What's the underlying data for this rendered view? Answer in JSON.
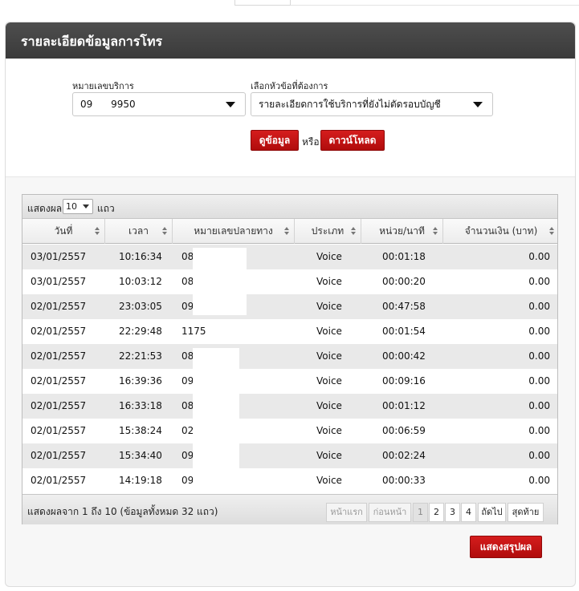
{
  "panel": {
    "title": "รายละเอียดข้อมูลการโทร"
  },
  "form": {
    "phone_label": "หมายเลขบริการ",
    "phone_value": "09      9950",
    "topic_label": "เลือกหัวข้อที่ต้องการ",
    "topic_value": "รายละเอียดการใช้บริการที่ยังไม่ตัดรอบบัญชี",
    "view_button": "ดูข้อมูล",
    "or_text": "หรือ",
    "download_button": "ดาวน์โหลด"
  },
  "table": {
    "show_label": "แสดงผล",
    "page_length": "10",
    "rows_label": "แถว",
    "columns": [
      "วันที่",
      "เวลา",
      "หมายเลขปลายทาง",
      "ประเภท",
      "หน่วย/นาที",
      "จำนวนเงิน (บาท)"
    ],
    "rows": [
      [
        "03/01/2557",
        "10:16:34",
        "08",
        "Voice",
        "00:01:18",
        "0.00"
      ],
      [
        "03/01/2557",
        "10:03:12",
        "08",
        "Voice",
        "00:00:20",
        "0.00"
      ],
      [
        "02/01/2557",
        "23:03:05",
        "09",
        "Voice",
        "00:47:58",
        "0.00"
      ],
      [
        "02/01/2557",
        "22:29:48",
        "1175",
        "Voice",
        "00:01:54",
        "0.00"
      ],
      [
        "02/01/2557",
        "22:21:53",
        "08",
        "Voice",
        "00:00:42",
        "0.00"
      ],
      [
        "02/01/2557",
        "16:39:36",
        "09",
        "Voice",
        "00:09:16",
        "0.00"
      ],
      [
        "02/01/2557",
        "16:33:18",
        "08",
        "Voice",
        "00:01:12",
        "0.00"
      ],
      [
        "02/01/2557",
        "15:38:24",
        "02",
        "Voice",
        "00:06:59",
        "0.00"
      ],
      [
        "02/01/2557",
        "15:34:40",
        "09",
        "Voice",
        "00:02:24",
        "0.00"
      ],
      [
        "02/01/2557",
        "14:19:18",
        "09",
        "Voice",
        "00:00:33",
        "0.00"
      ]
    ],
    "info": "แสดงผลจาก 1 ถึง 10 (ข้อมูลทั้งหมด 32 แถว)",
    "pagination": {
      "first": "หน้าแรก",
      "previous": "ก่อนหน้า",
      "pages": [
        "1",
        "2",
        "3",
        "4"
      ],
      "current_page": "1",
      "next": "ถัดไป",
      "last": "สุดท้าย"
    }
  },
  "summary_button": "แสดงสรุปผล",
  "colors": {
    "header_bg": "#444444",
    "button_red": "#c0140f",
    "row_alt": "#e9e9e9"
  }
}
